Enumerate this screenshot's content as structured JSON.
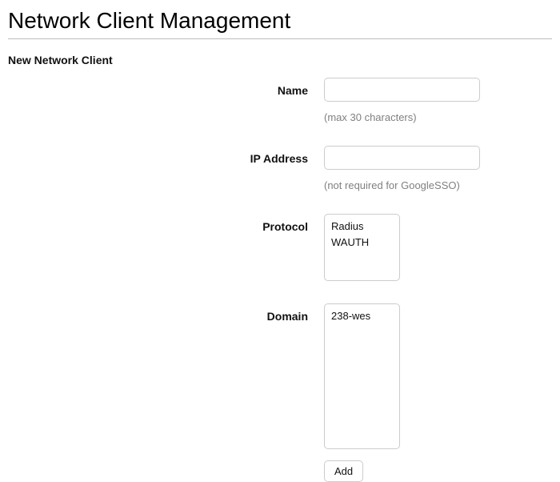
{
  "page_title": "Network Client Management",
  "section_title": "New Network Client",
  "fields": {
    "name": {
      "label": "Name",
      "value": "",
      "hint": "(max 30 characters)"
    },
    "ip": {
      "label": "IP Address",
      "value": "",
      "hint": "(not required for GoogleSSO)"
    },
    "protocol": {
      "label": "Protocol",
      "options": [
        "Radius",
        "WAUTH"
      ]
    },
    "domain": {
      "label": "Domain",
      "options": [
        "238-wes"
      ]
    }
  },
  "submit_label": "Add"
}
